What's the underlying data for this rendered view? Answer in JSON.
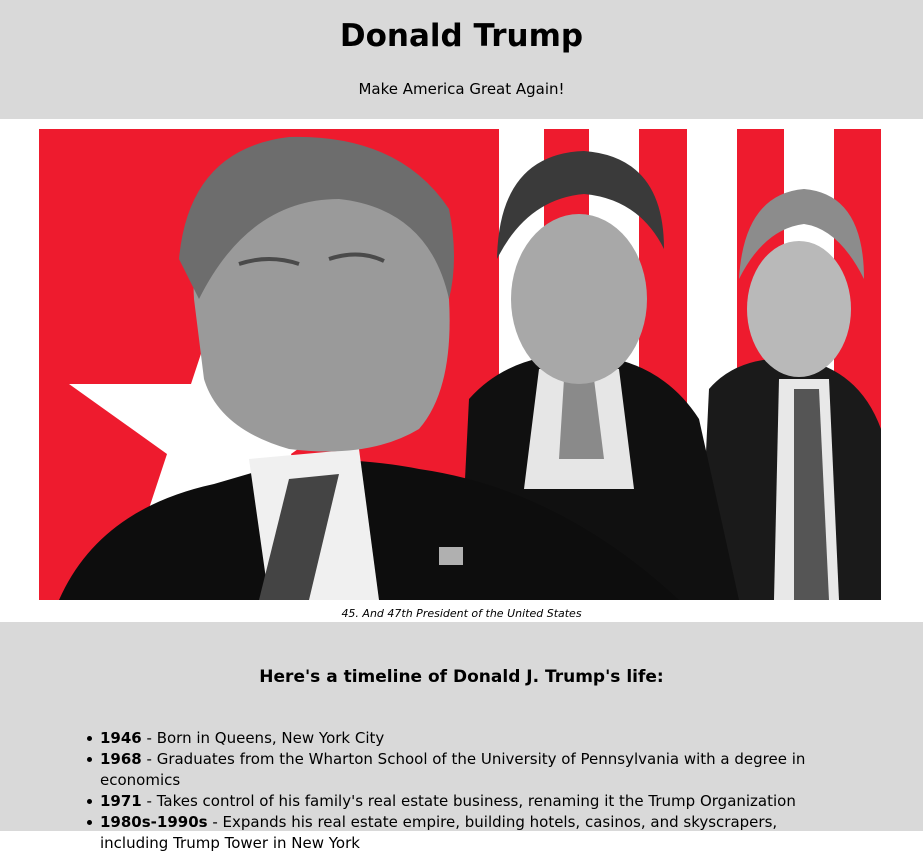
{
  "header": {
    "title": "Donald Trump",
    "tagline": "Make America Great Again!"
  },
  "figure": {
    "caption": "45. And 47th President of the United States",
    "colors": {
      "red": "#ee1b2e",
      "white": "#ffffff"
    }
  },
  "timeline": {
    "heading": "Here's a timeline of Donald J. Trump's life:",
    "items": [
      {
        "year": "1946",
        "text": " - Born in Queens, New York City"
      },
      {
        "year": "1968",
        "text": " - Graduates from the Wharton School of the University of Pennsylvania with a degree in economics"
      },
      {
        "year": "1971",
        "text": " - Takes control of his family's real estate business, renaming it the Trump Organization"
      },
      {
        "year": "1980s-1990s",
        "text": " - Expands his real estate empire, building hotels, casinos, and skyscrapers, including Trump Tower in New York"
      }
    ]
  }
}
